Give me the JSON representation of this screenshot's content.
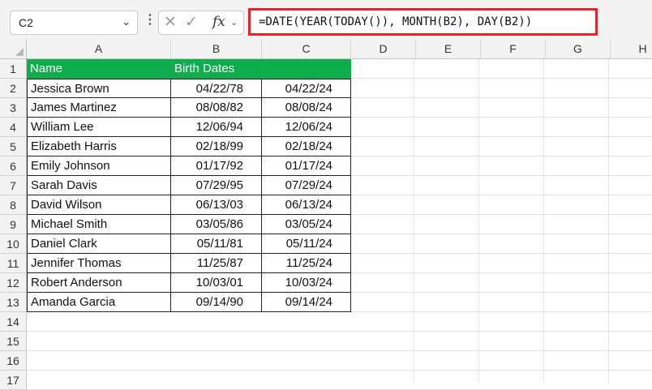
{
  "name_box": {
    "value": "C2"
  },
  "formula_bar": {
    "cancel_glyph": "✕",
    "enter_glyph": "✓",
    "fx_label": "fx",
    "formula": "=DATE(YEAR(TODAY()), MONTH(B2), DAY(B2))"
  },
  "columns": [
    "A",
    "B",
    "C",
    "D",
    "E",
    "F",
    "G",
    "H"
  ],
  "row_numbers": [
    "1",
    "2",
    "3",
    "4",
    "5",
    "6",
    "7",
    "8",
    "9",
    "10",
    "11",
    "12",
    "13",
    "14",
    "15",
    "16",
    "17"
  ],
  "table": {
    "headers": [
      "Name",
      "Birth Dates",
      ""
    ],
    "header_color": "#0fad4e",
    "rows": [
      [
        "Jessica Brown",
        "04/22/78",
        "04/22/24"
      ],
      [
        "James Martinez",
        "08/08/82",
        "08/08/24"
      ],
      [
        "William Lee",
        "12/06/94",
        "12/06/24"
      ],
      [
        "Elizabeth Harris",
        "02/18/99",
        "02/18/24"
      ],
      [
        "Emily Johnson",
        "01/17/92",
        "01/17/24"
      ],
      [
        "Sarah Davis",
        "07/29/95",
        "07/29/24"
      ],
      [
        "David Wilson",
        "06/13/03",
        "06/13/24"
      ],
      [
        "Michael Smith",
        "03/05/86",
        "03/05/24"
      ],
      [
        "Daniel Clark",
        "05/11/81",
        "05/11/24"
      ],
      [
        "Jennifer Thomas",
        "11/25/87",
        "11/25/24"
      ],
      [
        "Robert Anderson",
        "10/03/01",
        "10/03/24"
      ],
      [
        "Amanda Garcia",
        "09/14/90",
        "09/14/24"
      ]
    ]
  },
  "highlight_color": "#e8232b"
}
